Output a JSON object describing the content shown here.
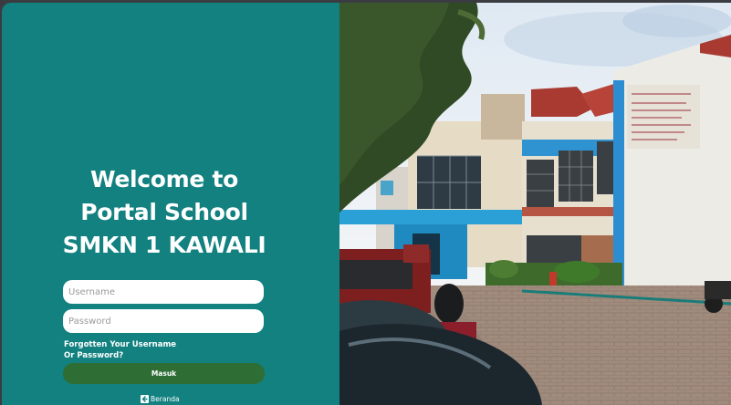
{
  "login": {
    "title_lines": [
      "Welcome to",
      "Portal School",
      "SMKN 1 KAWALI"
    ],
    "username_placeholder": "Username",
    "password_placeholder": "Password",
    "forgot_line1": "Forgotten Your Username",
    "forgot_line2": "Or Password?",
    "submit_label": "Masuk",
    "home_label": "Beranda",
    "home_icon": "arrow-left-icon"
  },
  "colors": {
    "panel": "#128180",
    "button": "#2e6e35",
    "text": "#ffffff"
  },
  "photo": {
    "subject": "school-building-photo"
  }
}
